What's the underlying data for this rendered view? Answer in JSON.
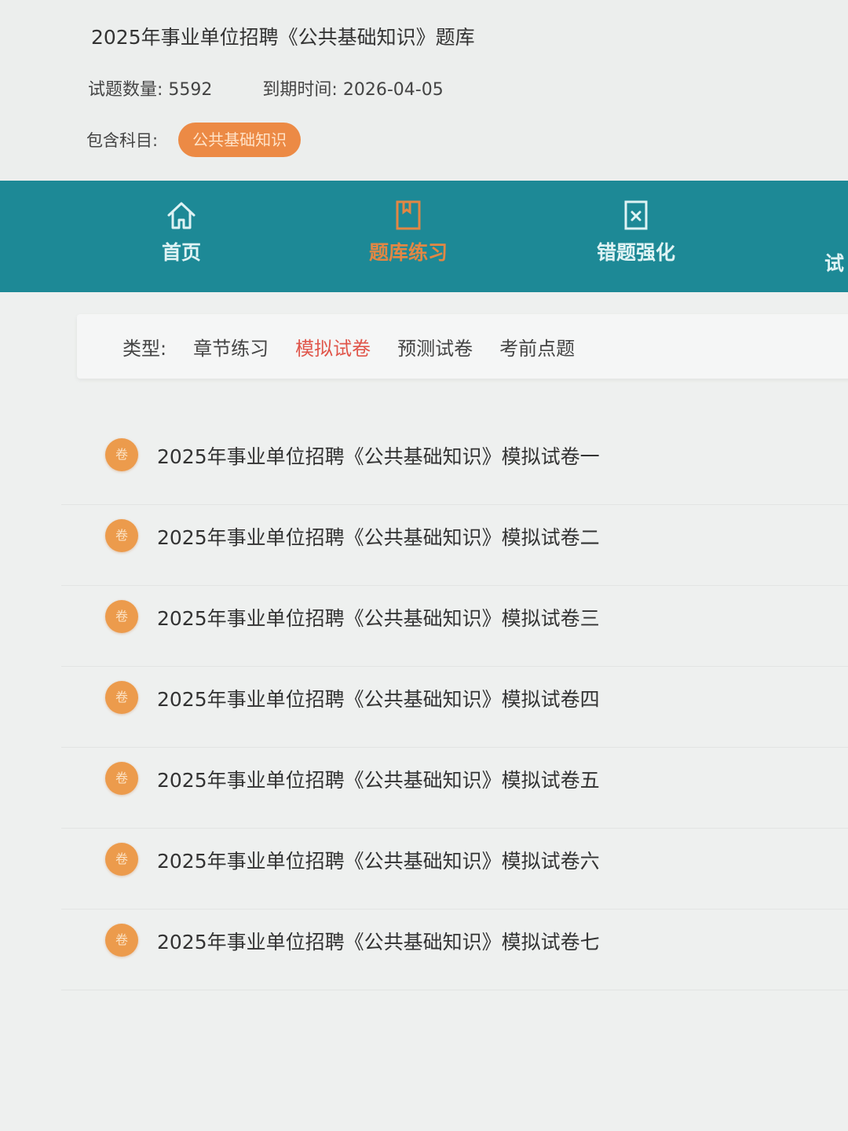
{
  "header": {
    "title": "2025年事业单位招聘《公共基础知识》题库",
    "question_count_label": "试题数量:",
    "question_count": "5592",
    "expiry_label": "到期时间:",
    "expiry_date": "2026-04-05",
    "subjects_label": "包含科目:",
    "subject_tag": "公共基础知识"
  },
  "nav": {
    "items": [
      {
        "label": "首页",
        "icon": "home-icon"
      },
      {
        "label": "题库练习",
        "icon": "book-icon",
        "active": true
      },
      {
        "label": "错题强化",
        "icon": "wrong-question-icon"
      },
      {
        "label": "试"
      }
    ]
  },
  "filter": {
    "label": "类型:",
    "options": [
      "章节练习",
      "模拟试卷",
      "预测试卷",
      "考前点题"
    ],
    "active": "模拟试卷"
  },
  "papers": {
    "badge_text": "卷",
    "items": [
      "2025年事业单位招聘《公共基础知识》模拟试卷一",
      "2025年事业单位招聘《公共基础知识》模拟试卷二",
      "2025年事业单位招聘《公共基础知识》模拟试卷三",
      "2025年事业单位招聘《公共基础知识》模拟试卷四",
      "2025年事业单位招聘《公共基础知识》模拟试卷五",
      "2025年事业单位招聘《公共基础知识》模拟试卷六",
      "2025年事业单位招聘《公共基础知识》模拟试卷七"
    ]
  },
  "colors": {
    "nav_bg": "#1d8996",
    "accent_orange": "#ec8a45",
    "active_red": "#e0554a"
  }
}
